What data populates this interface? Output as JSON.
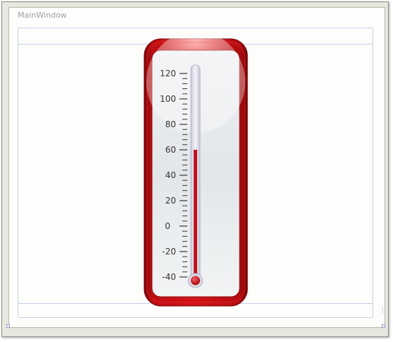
{
  "window": {
    "title": "MainWindow"
  },
  "thermometer": {
    "scale_min": -40,
    "scale_max": 120,
    "current_value": 60,
    "major_step": 20,
    "minor_step": 4,
    "tick_labels": [
      "120",
      "100",
      "80",
      "60",
      "40",
      "20",
      "0",
      "-20",
      "-40"
    ],
    "colors": {
      "frame": "#b50a0d",
      "mercury": "#c0141b",
      "face": "#e9ecee"
    }
  }
}
